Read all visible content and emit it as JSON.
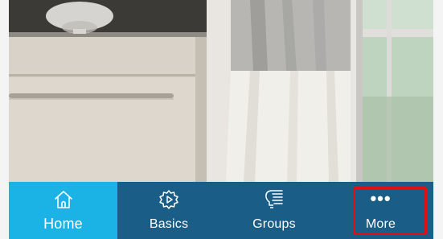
{
  "nav": {
    "items": [
      {
        "id": "home",
        "label": "Home",
        "icon": "home-icon",
        "active": true
      },
      {
        "id": "basics",
        "label": "Basics",
        "icon": "gear-play-icon",
        "active": false
      },
      {
        "id": "groups",
        "label": "Groups",
        "icon": "lightbulb-list-icon",
        "active": false
      },
      {
        "id": "more",
        "label": "More",
        "icon": "more-dots-icon",
        "active": false
      }
    ],
    "more_dots": "•••"
  },
  "colors": {
    "nav_background": "#1a5d86",
    "active_tab": "#1bb3e6",
    "highlight": "#e01010"
  }
}
